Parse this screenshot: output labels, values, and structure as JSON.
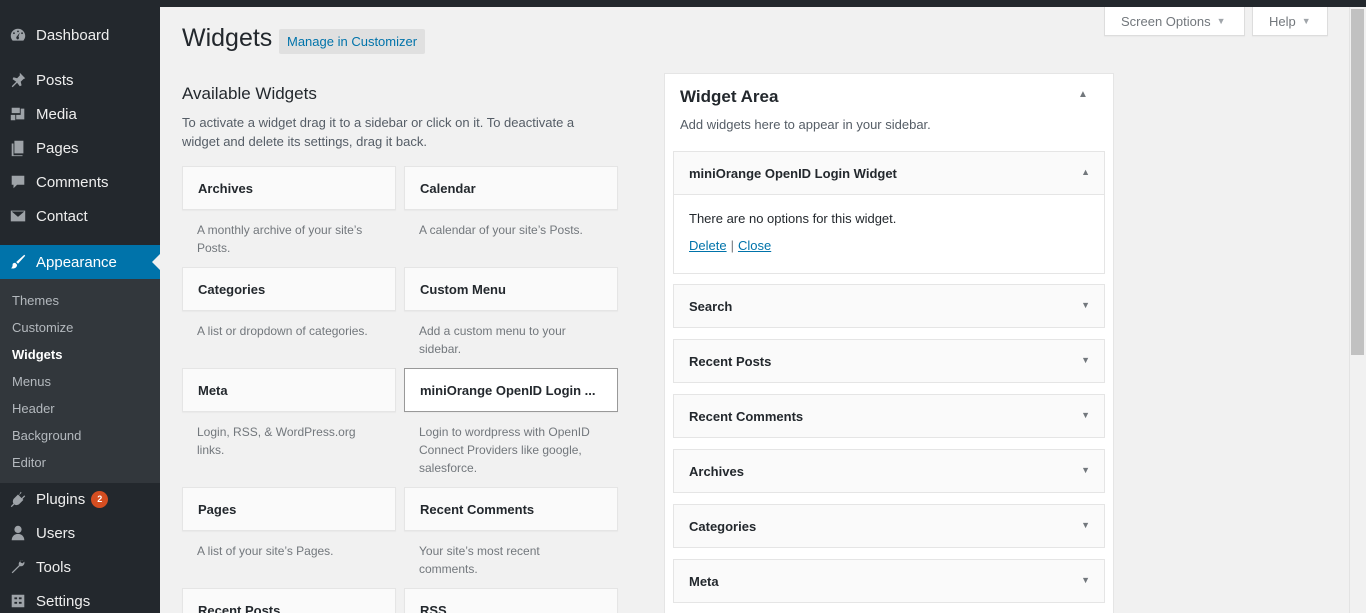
{
  "menu": {
    "items": [
      {
        "label": "Dashboard",
        "icon": "dashboard-icon"
      },
      {
        "label": "Posts",
        "icon": "pushpin-icon"
      },
      {
        "label": "Media",
        "icon": "media-icon"
      },
      {
        "label": "Pages",
        "icon": "pages-icon"
      },
      {
        "label": "Comments",
        "icon": "comment-icon"
      },
      {
        "label": "Contact",
        "icon": "envelope-icon"
      },
      {
        "label": "Appearance",
        "icon": "paintbrush-icon"
      },
      {
        "label": "Plugins",
        "icon": "plugin-icon",
        "badge": "2"
      },
      {
        "label": "Users",
        "icon": "user-icon"
      },
      {
        "label": "Tools",
        "icon": "wrench-icon"
      },
      {
        "label": "Settings",
        "icon": "settings-icon"
      }
    ],
    "submenu": [
      "Themes",
      "Customize",
      "Widgets",
      "Menus",
      "Header",
      "Background",
      "Editor"
    ]
  },
  "screen_meta": {
    "screen_options": "Screen Options",
    "help": "Help"
  },
  "header": {
    "title": "Widgets",
    "customizer": "Manage in Customizer"
  },
  "available": {
    "title": "Available Widgets",
    "description": "To activate a widget drag it to a sidebar or click on it. To deactivate a widget and delete its settings, drag it back.",
    "widgets": [
      {
        "title": "Archives",
        "desc": "A monthly archive of your site’s Posts."
      },
      {
        "title": "Calendar",
        "desc": "A calendar of your site’s Posts."
      },
      {
        "title": "Categories",
        "desc": "A list or dropdown of categories."
      },
      {
        "title": "Custom Menu",
        "desc": "Add a custom menu to your sidebar."
      },
      {
        "title": "Meta",
        "desc": "Login, RSS, & WordPress.org links."
      },
      {
        "title": "miniOrange OpenID Login ...",
        "desc": "Login to wordpress with OpenID Connect Providers like google, salesforce."
      },
      {
        "title": "Pages",
        "desc": "A list of your site’s Pages."
      },
      {
        "title": "Recent Comments",
        "desc": "Your site’s most recent comments."
      },
      {
        "title": "Recent Posts",
        "desc": ""
      },
      {
        "title": "RSS",
        "desc": ""
      }
    ]
  },
  "widget_area": {
    "title": "Widget Area",
    "description": "Add widgets here to appear in your sidebar.",
    "expanded": {
      "title": "miniOrange OpenID Login Widget",
      "no_options": "There are no options for this widget.",
      "delete": "Delete",
      "sep": "|",
      "close": "Close"
    },
    "items": [
      "Search",
      "Recent Posts",
      "Recent Comments",
      "Archives",
      "Categories",
      "Meta"
    ]
  },
  "colors": {
    "accent": "#0073aa",
    "sidebar": "#23282d",
    "badge": "#d54e21"
  }
}
